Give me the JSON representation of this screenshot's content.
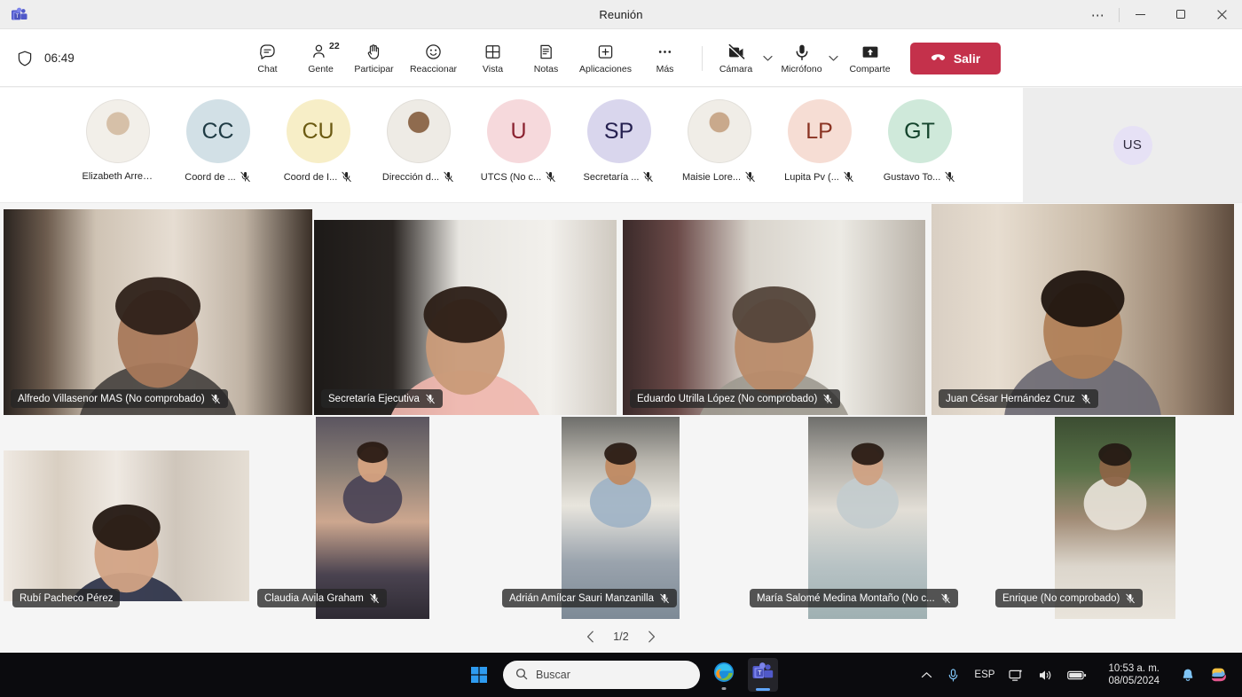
{
  "window": {
    "title": "Reunión",
    "app_icon": "teams-icon",
    "controls": {
      "more": "⋯",
      "minimize": "─",
      "maximize": "❐",
      "close": "✕"
    }
  },
  "toolbar": {
    "shield_icon": "shield-icon",
    "timer": "06:49",
    "items": [
      {
        "label": "Chat",
        "icon": "chat-icon",
        "badge": ""
      },
      {
        "label": "Gente",
        "icon": "people-icon",
        "badge": "22"
      },
      {
        "label": "Participar",
        "icon": "raise-hand-icon",
        "badge": ""
      },
      {
        "label": "Reaccionar",
        "icon": "emoji-icon",
        "badge": ""
      },
      {
        "label": "Vista",
        "icon": "grid-view-icon",
        "badge": ""
      },
      {
        "label": "Notas",
        "icon": "notes-icon",
        "badge": ""
      },
      {
        "label": "Aplicaciones",
        "icon": "apps-plus-icon",
        "badge": ""
      },
      {
        "label": "Más",
        "icon": "more-dots-icon",
        "badge": ""
      }
    ],
    "camera": {
      "label": "Cámara",
      "icon": "camera-off-icon",
      "caret": "⌄"
    },
    "microphone": {
      "label": "Micrófono",
      "icon": "microphone-icon",
      "caret": "⌄"
    },
    "share": {
      "label": "Comparte",
      "icon": "share-screen-icon"
    },
    "leave": {
      "label": "Salir",
      "icon": "hangup-icon",
      "color": "#c4314b"
    }
  },
  "roster": {
    "participants": [
      {
        "name": "Elizabeth Arred...",
        "initials": "",
        "type": "photo",
        "photo": "woman-white-blazer",
        "bg": "#dcdcdc",
        "fg": "#242424",
        "muted": false
      },
      {
        "name": "Coord de ...",
        "initials": "CC",
        "type": "initials",
        "bg": "#d2e0e6",
        "fg": "#1f3b44",
        "muted": true
      },
      {
        "name": "Coord de I...",
        "initials": "CU",
        "type": "initials",
        "bg": "#f7eec7",
        "fg": "#6b5a12",
        "muted": true
      },
      {
        "name": "Dirección d...",
        "initials": "",
        "type": "photo",
        "photo": "man-white-shirt",
        "bg": "#dcdcdc",
        "fg": "#242424",
        "muted": true
      },
      {
        "name": "UTCS (No c...",
        "initials": "U",
        "type": "initials",
        "bg": "#f6d9dc",
        "fg": "#8b2230",
        "muted": true
      },
      {
        "name": "Secretaría ...",
        "initials": "SP",
        "type": "initials",
        "bg": "#d9d6ed",
        "fg": "#252050",
        "muted": true
      },
      {
        "name": "Maisie Lore...",
        "initials": "",
        "type": "photo",
        "photo": "woman-white-dress",
        "bg": "#dcdcdc",
        "fg": "#242424",
        "muted": true
      },
      {
        "name": "Lupita Pv (...",
        "initials": "LP",
        "type": "initials",
        "bg": "#f6ddd4",
        "fg": "#8a3322",
        "muted": true
      },
      {
        "name": "Gustavo To...",
        "initials": "GT",
        "type": "initials",
        "bg": "#cfe9da",
        "fg": "#14442c",
        "muted": true
      }
    ],
    "self": {
      "initials": "US",
      "bg": "#e6e1f5",
      "fg": "#2f2a3d"
    },
    "mute_icon": "microphone-muted-icon"
  },
  "stage": {
    "tiles_row1": [
      {
        "name": "Alfredo Villasenor MAS (No comprobado)",
        "muted": true,
        "scene": "man-dark-polo-office"
      },
      {
        "name": "Secretaría Ejecutiva",
        "muted": true,
        "scene": "woman-pink-blouse-whiteboard"
      },
      {
        "name": "Eduardo Utrilla López (No comprobado)",
        "muted": true,
        "scene": "man-striped-shirt-office"
      },
      {
        "name": "Juan César Hernández Cruz",
        "muted": true,
        "scene": "man-beard-closeup"
      }
    ],
    "tiles_row2": [
      {
        "name": "Rubí Pacheco Pérez",
        "muted": false,
        "scene": "woman-navy-top-shelves"
      },
      {
        "name": "Claudia Ávila Graham",
        "muted": true,
        "scene": "woman-patterned-jacket"
      },
      {
        "name": "Adrián Amílcar Sauri Manzanilla",
        "muted": true,
        "scene": "man-blue-shirt-car"
      },
      {
        "name": "María Salomé Medina Montaño (No c...",
        "muted": true,
        "scene": "woman-glasses-car"
      },
      {
        "name": "Enrique (No comprobado)",
        "muted": true,
        "scene": "man-white-shirt-green-wall"
      }
    ],
    "pagination": {
      "prev_icon": "chevron-left-icon",
      "next_icon": "chevron-right-icon",
      "label": "1/2"
    }
  },
  "taskbar": {
    "start_icon": "windows-start-icon",
    "search": {
      "icon": "search-icon",
      "placeholder": "Buscar"
    },
    "apps": [
      {
        "icon": "edge-icon",
        "name": "Microsoft Edge",
        "state": "running"
      },
      {
        "icon": "teams-icon",
        "name": "Microsoft Teams",
        "state": "active"
      }
    ],
    "tray": {
      "overflow_icon": "chevron-up-icon",
      "mic_icon": "microphone-icon",
      "language": "ESP",
      "network_icon": "network-icon",
      "volume_icon": "volume-icon",
      "battery_icon": "battery-icon",
      "time": "10:53 a. m.",
      "date": "08/05/2024",
      "bell_icon": "bell-icon",
      "copilot_icon": "copilot-icon"
    }
  }
}
